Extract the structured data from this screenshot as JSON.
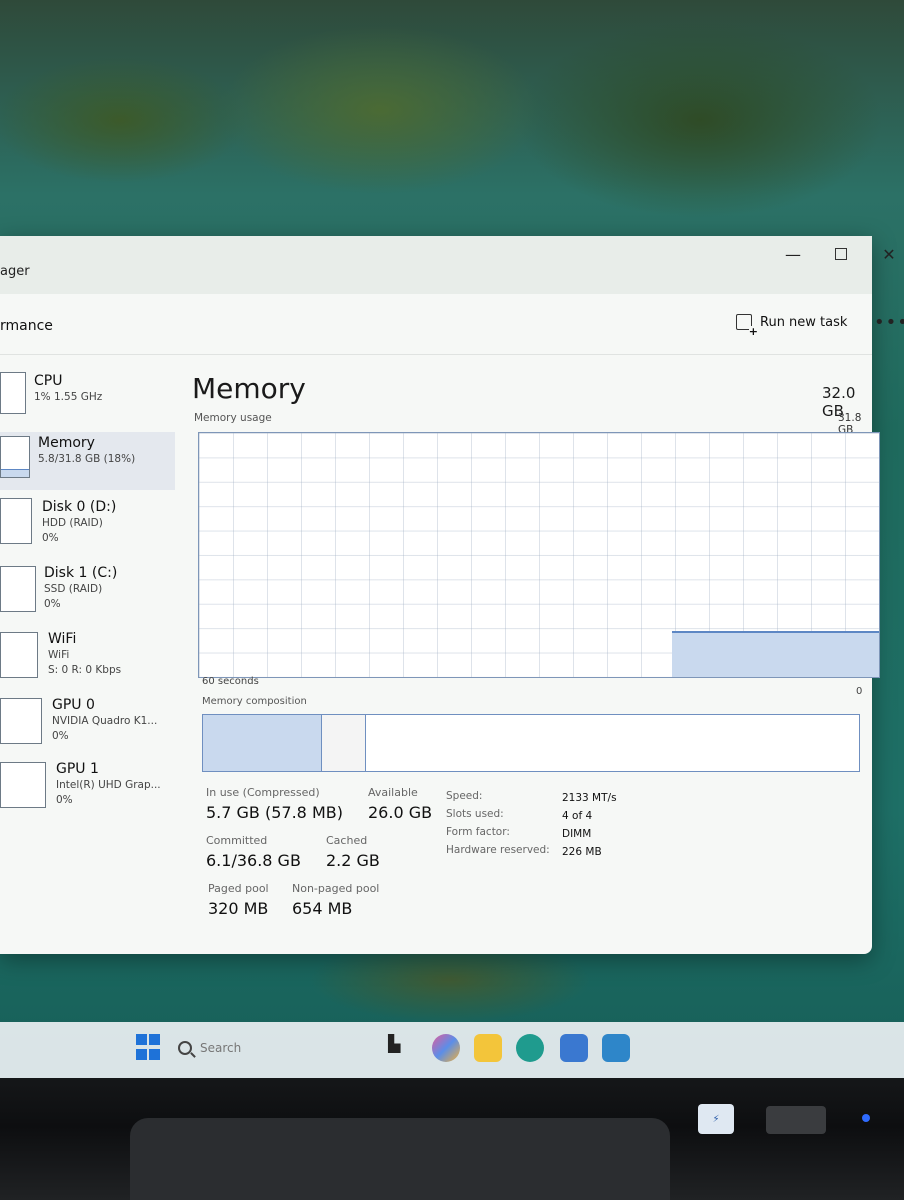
{
  "window": {
    "title": "ager",
    "page_title": "rmance",
    "run_new_task": "Run new task",
    "more": "•••",
    "minimize": "—",
    "close": "✕"
  },
  "sidebar": {
    "items": [
      {
        "name": "CPU",
        "line1": "1% 1.55 GHz",
        "line2": ""
      },
      {
        "name": "Memory",
        "line1": "5.8/31.8 GB (18%)",
        "line2": ""
      },
      {
        "name": "Disk 0 (D:)",
        "line1": "HDD (RAID)",
        "line2": "0%"
      },
      {
        "name": "Disk 1 (C:)",
        "line1": "SSD (RAID)",
        "line2": "0%"
      },
      {
        "name": "WiFi",
        "line1": "WiFi",
        "line2": "S: 0 R: 0 Kbps"
      },
      {
        "name": "GPU 0",
        "line1": "NVIDIA Quadro K1...",
        "line2": "0%"
      },
      {
        "name": "GPU 1",
        "line1": "Intel(R) UHD Grap...",
        "line2": "0%"
      }
    ]
  },
  "memory": {
    "title": "Memory",
    "total": "32.0 GB",
    "usage_label": "Memory usage",
    "usage_max": "31.8 GB",
    "graph_left": "60 seconds",
    "graph_right": "0",
    "usage_fraction": 0.18,
    "composition_label": "Memory composition",
    "stats": {
      "in_use_label": "In use (Compressed)",
      "in_use_value": "5.7 GB (57.8 MB)",
      "available_label": "Available",
      "available_value": "26.0 GB",
      "committed_label": "Committed",
      "committed_value": "6.1/36.8 GB",
      "cached_label": "Cached",
      "cached_value": "2.2 GB",
      "paged_label": "Paged pool",
      "paged_value": "320 MB",
      "nonpaged_label": "Non-paged pool",
      "nonpaged_value": "654 MB"
    },
    "details": {
      "speed_label": "Speed:",
      "speed_value": "2133 MT/s",
      "slots_label": "Slots used:",
      "slots_value": "4 of 4",
      "form_label": "Form factor:",
      "form_value": "DIMM",
      "hw_label": "Hardware reserved:",
      "hw_value": "226 MB"
    }
  },
  "taskbar": {
    "search_placeholder": "Search"
  },
  "colors": {
    "accent": "#5d87c4",
    "fill": "#c9d9ee",
    "selected_bg": "#e4e8ee"
  }
}
